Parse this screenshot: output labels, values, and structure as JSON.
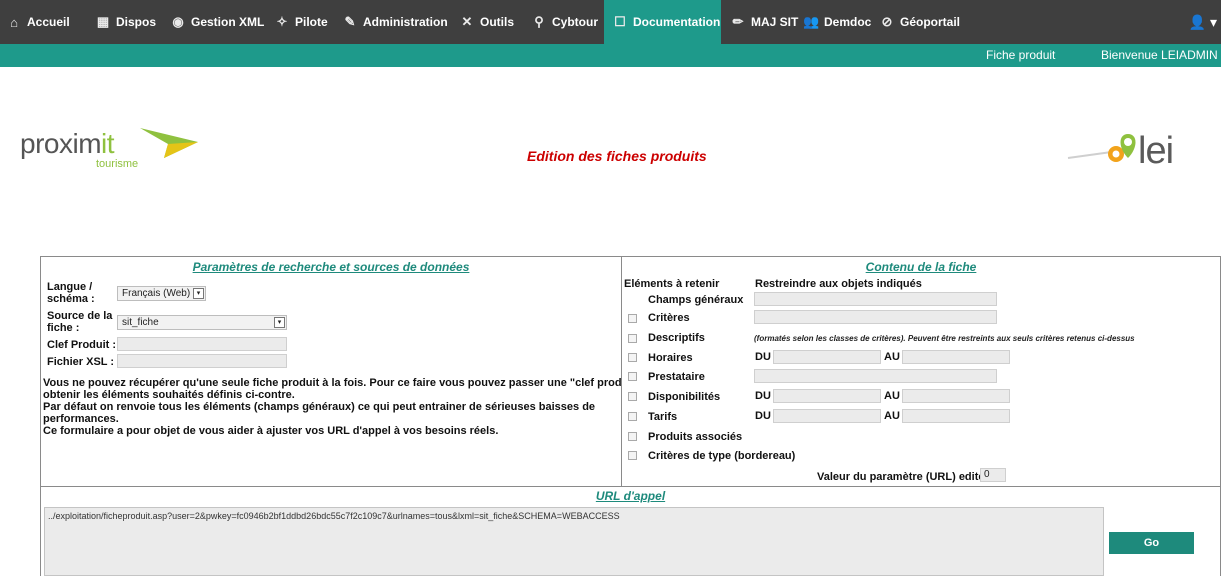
{
  "nav": {
    "items": [
      {
        "label": "Accueil",
        "icon": "home-icon",
        "glyph": "⌂"
      },
      {
        "label": "Dispos",
        "icon": "calendar-icon",
        "glyph": "▦"
      },
      {
        "label": "Gestion XML",
        "icon": "globe-icon",
        "glyph": "◉"
      },
      {
        "label": "Pilote",
        "icon": "wand-icon",
        "glyph": "✧"
      },
      {
        "label": "Administration",
        "icon": "signature-icon",
        "glyph": "✎"
      },
      {
        "label": "Outils",
        "icon": "tools-icon",
        "glyph": "✕"
      },
      {
        "label": "Cybtour",
        "icon": "search-icon",
        "glyph": "⚲"
      },
      {
        "label": "Documentation",
        "icon": "document-icon",
        "glyph": "☐"
      },
      {
        "label": "MAJ SIT",
        "icon": "edit-icon",
        "glyph": "✏"
      },
      {
        "label": "Demdoc",
        "icon": "group-icon",
        "glyph": "👥"
      },
      {
        "label": "Géoportail",
        "icon": "compass-icon",
        "glyph": "⊘"
      }
    ],
    "user_glyph": "👤 ▾",
    "active_color": "#1e9a8b"
  },
  "subbar": {
    "fiche_produit": "Fiche produit",
    "welcome": "Bienvenue LEIADMIN"
  },
  "logos": {
    "left_word_a": "proxim",
    "left_word_b": "it",
    "left_sub": "tourisme",
    "right_word": "lei"
  },
  "page_title": "Edition des fiches produits",
  "params": {
    "title": "Paramètres de recherche et sources de données",
    "langue_label_1": "Langue /",
    "langue_label_2": "schéma :",
    "langue_value": "Français (Web)",
    "source_label_1": "Source de la",
    "source_label_2": "fiche :",
    "source_value": "sit_fiche",
    "clef_label": "Clef Produit :",
    "clef_value": "",
    "xsl_label": "Fichier XSL :",
    "xsl_value": "",
    "help_1": "Vous ne pouvez récupérer qu'une seule fiche produit à la fois. Pour ce faire vous pouvez passer une \"clef produit\" et",
    "help_2": "obtenir les éléments souhaités définis ci-contre.",
    "help_3": "Par défaut on renvoie tous les éléments (champs généraux) ce qui peut entrainer de sérieuses baisses de",
    "help_4": "performances.",
    "help_5": "Ce formulaire a pour objet de vous aider à ajuster vos URL d'appel à vos besoins réels."
  },
  "contenu": {
    "title": "Contenu de la fiche",
    "col_left": "Eléments à retenir",
    "col_right": "Restreindre aux objets indiqués",
    "champs_generaux": "Champs généraux",
    "criteres": "Critères",
    "descriptifs": "Descriptifs",
    "descriptifs_note": "(formatés selon les classes de critères). Peuvent être restreints aux seuls critères retenus ci-dessus",
    "horaires": "Horaires",
    "prestataire": "Prestataire",
    "disponibilites": "Disponibilités",
    "tarifs": "Tarifs",
    "produits_associes": "Produits associés",
    "criteres_type": "Critères de type (bordereau)",
    "du": "DU",
    "au": "AU",
    "valeur_label": "Valeur du paramètre (URL) editer",
    "valeur_value": "0"
  },
  "url": {
    "title": "URL d'appel",
    "value": "../exploitation/ficheproduit.asp?user=2&pwkey=fc0946b2bf1ddbd26bdc55c7f2c109c7&urlnames=tous&lxml=sit_fiche&SCHEMA=WEBACCESS",
    "go_label": "Go"
  }
}
